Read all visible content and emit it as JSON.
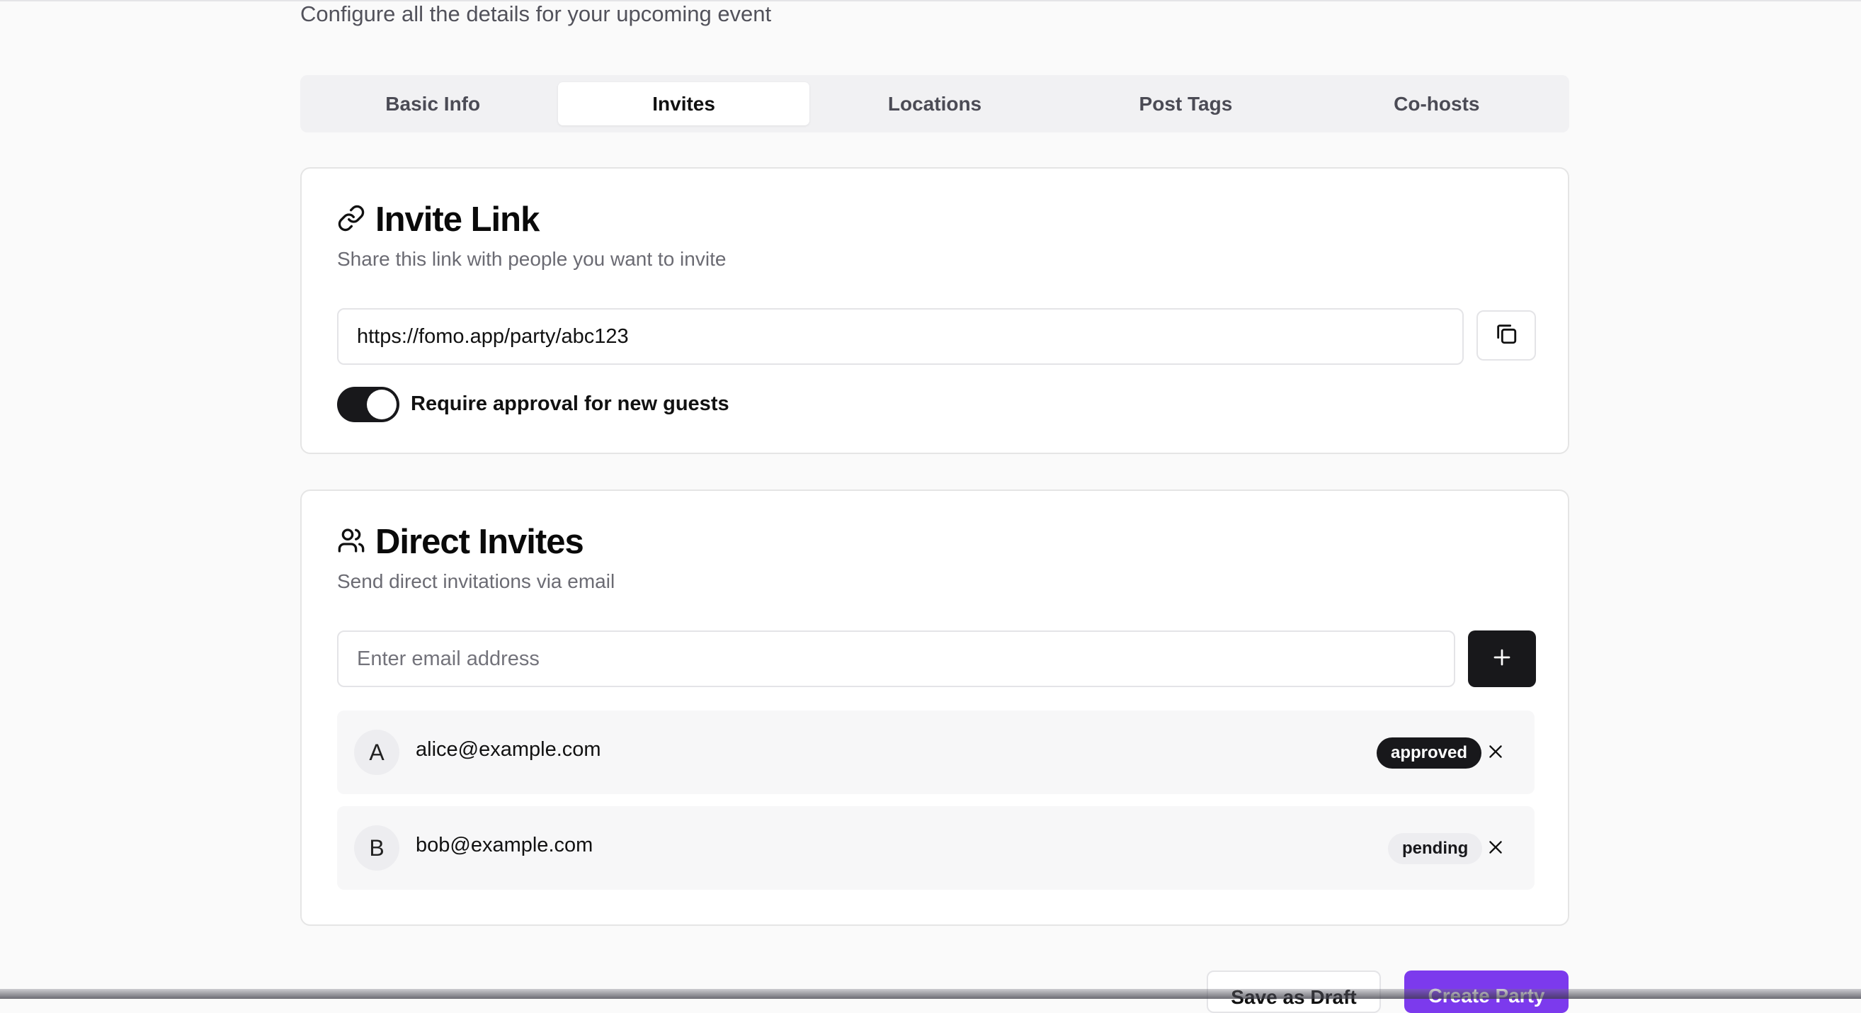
{
  "page": {
    "subtitle": "Configure all the details for your upcoming event"
  },
  "tabs": [
    {
      "label": "Basic Info",
      "active": false
    },
    {
      "label": "Invites",
      "active": true
    },
    {
      "label": "Locations",
      "active": false
    },
    {
      "label": "Post Tags",
      "active": false
    },
    {
      "label": "Co-hosts",
      "active": false
    }
  ],
  "invite_link": {
    "title": "Invite Link",
    "description": "Share this link with people you want to invite",
    "url": "https://fomo.app/party/abc123",
    "require_approval_label": "Require approval for new guests",
    "require_approval_on": true,
    "icons": {
      "title": "link-icon",
      "copy": "copy-icon"
    }
  },
  "direct_invites": {
    "title": "Direct Invites",
    "description": "Send direct invitations via email",
    "email_placeholder": "Enter email address",
    "icons": {
      "title": "users-icon",
      "add": "plus-icon",
      "remove": "close-icon"
    },
    "invites": [
      {
        "initial": "A",
        "email": "alice@example.com",
        "status": "approved"
      },
      {
        "initial": "B",
        "email": "bob@example.com",
        "status": "pending"
      }
    ]
  },
  "footer": {
    "save_draft_label": "Save as Draft",
    "create_label": "Create Party"
  },
  "colors": {
    "primary": "#7c3aed",
    "dark": "#18181b",
    "background": "#fafafa"
  }
}
